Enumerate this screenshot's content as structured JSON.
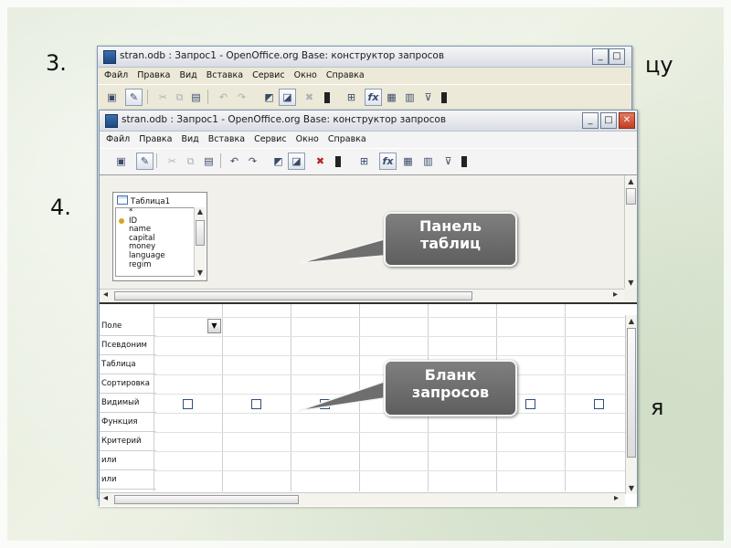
{
  "slide": {
    "num3": "3.",
    "num4": "4.",
    "frag_right_top": "цу",
    "frag_right_bottom": "я"
  },
  "back_window": {
    "title": "stran.odb : Запрос1 - OpenOffice.org Base: конструктор запросов",
    "menu": [
      "Файл",
      "Правка",
      "Вид",
      "Вставка",
      "Сервис",
      "Окно",
      "Справка"
    ]
  },
  "front_window": {
    "title": "stran.odb : Запрос1 - OpenOffice.org Base: конструктор запросов",
    "menu": [
      "Файл",
      "Правка",
      "Вид",
      "Вставка",
      "Сервис",
      "Окно",
      "Справка"
    ],
    "min_label": "_",
    "max_label": "□",
    "close_label": "✕"
  },
  "table_box": {
    "title": "Таблица1",
    "fields": [
      "*",
      "ID",
      "name",
      "capital",
      "money",
      "language",
      "regim"
    ]
  },
  "grid": {
    "row_labels": [
      "Поле",
      "Псевдоним",
      "Таблица",
      "Сортировка",
      "Видимый",
      "Функция",
      "Критерий",
      "или",
      "или"
    ],
    "visible_checkboxes": 7
  },
  "callouts": {
    "tables_panel": [
      "Панель",
      "таблиц"
    ],
    "query_form": [
      "Бланк",
      "запросов"
    ]
  },
  "icons": {
    "save": "save-icon",
    "edit": "edit-icon",
    "cut": "cut-icon",
    "copy": "copy-icon",
    "paste": "paste-icon",
    "undo": "undo-icon",
    "redo": "redo-icon",
    "design": "design-view-icon",
    "add_table": "add-table-icon",
    "function": "function-icon",
    "filter": "filter-icon"
  },
  "colors": {
    "callout_bg": "#6e6e6e",
    "window_bg": "#ece9d8",
    "close_button": "#c43f22"
  }
}
